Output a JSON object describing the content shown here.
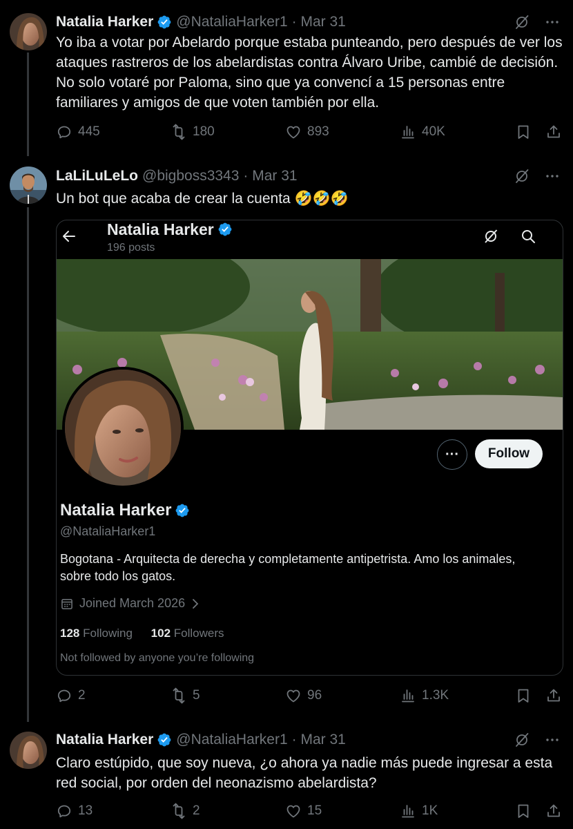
{
  "tweets": [
    {
      "name": "Natalia Harker",
      "handle": "@NataliaHarker1",
      "date": "· Mar 31",
      "text": "Yo iba a votar por Abelardo porque estaba punteando, pero después de ver los ataques rastreros de los abelardistas contra Álvaro Uribe, cambié de decisión. No solo votaré por Paloma, sino que ya convencí a 15 personas entre familiares y amigos de que voten también por ella.",
      "replies": "445",
      "reposts": "180",
      "likes": "893",
      "views": "40K"
    },
    {
      "name": "LaLiLuLeLo",
      "handle": "@bigboss3343",
      "date": "· Mar 31",
      "text": "Un bot que acaba de crear la cuenta 🤣🤣🤣",
      "replies": "2",
      "reposts": "5",
      "likes": "96",
      "views": "1.3K"
    },
    {
      "name": "Natalia Harker",
      "handle": "@NataliaHarker1",
      "date": "· Mar 31",
      "text": "Claro estúpido, que soy nueva, ¿o ahora ya nadie más puede ingresar a esta red social, por orden del neonazismo abelardista?",
      "replies": "13",
      "reposts": "2",
      "likes": "15",
      "views": "1K"
    }
  ],
  "profile_card": {
    "header_name": "Natalia Harker",
    "posts": "196 posts",
    "name": "Natalia Harker",
    "handle": "@NataliaHarker1",
    "bio": "Bogotana - Arquitecta de derecha y completamente antipetrista. Amo los animales, sobre todo los gatos.",
    "joined": "Joined March 2026",
    "following_count": "128",
    "following_label": "Following",
    "followers_count": "102",
    "followers_label": "Followers",
    "not_followed": "Not followed by anyone you’re following",
    "follow_label": "Follow",
    "more_label": "···"
  },
  "icons": {
    "verified": "verified-badge-icon",
    "grok": "grok-icon",
    "more": "more-icon",
    "reply": "reply-icon",
    "repost": "repost-icon",
    "like": "heart-icon",
    "views": "views-icon",
    "bookmark": "bookmark-icon",
    "share": "share-icon"
  },
  "colors": {
    "background": "#000000",
    "text": "#e7e9ea",
    "muted": "#71767b",
    "verified": "#1d9bf0",
    "border": "#2f3336"
  }
}
